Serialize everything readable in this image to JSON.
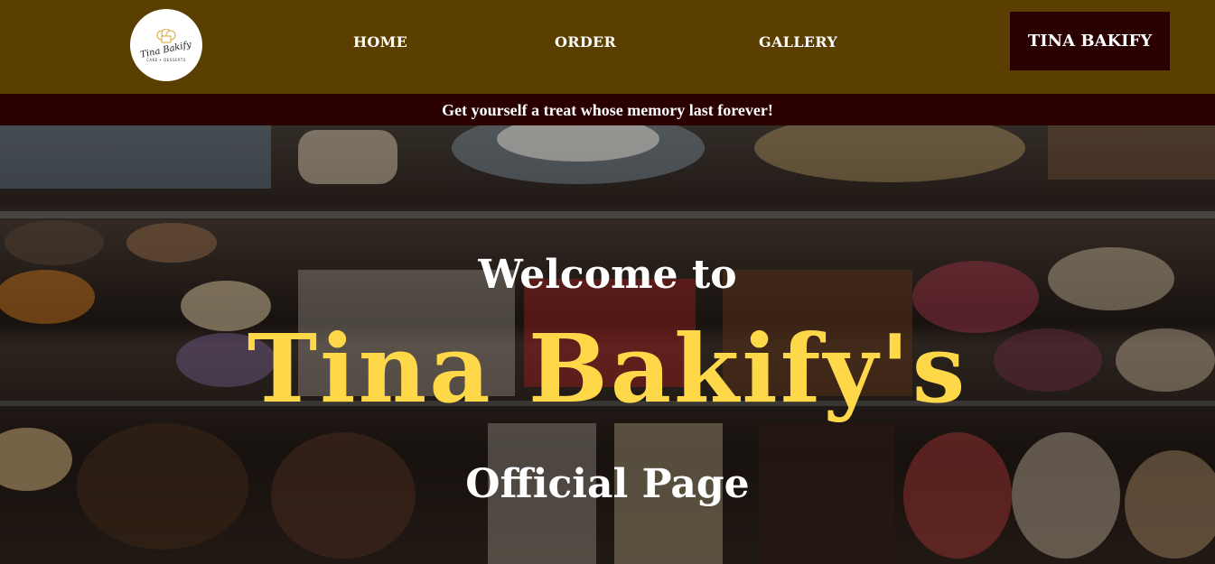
{
  "nav": {
    "logo_text": "Tina Bakify",
    "logo_subtext": "CAKE • DESSERTS",
    "links": [
      "HOME",
      "ORDER",
      "GALLERY"
    ],
    "brand_button": "TINA BAKIFY"
  },
  "tagline": "Get yourself a treat whose memory last forever!",
  "hero": {
    "welcome": "Welcome to",
    "name": "Tina Bakify's",
    "subtitle": "Official Page",
    "name_color": "#ffd84a"
  },
  "colors": {
    "nav_bg": "#5a3f00",
    "accent_dark": "#2a0000"
  },
  "icons": [
    "chef-hat-icon"
  ]
}
